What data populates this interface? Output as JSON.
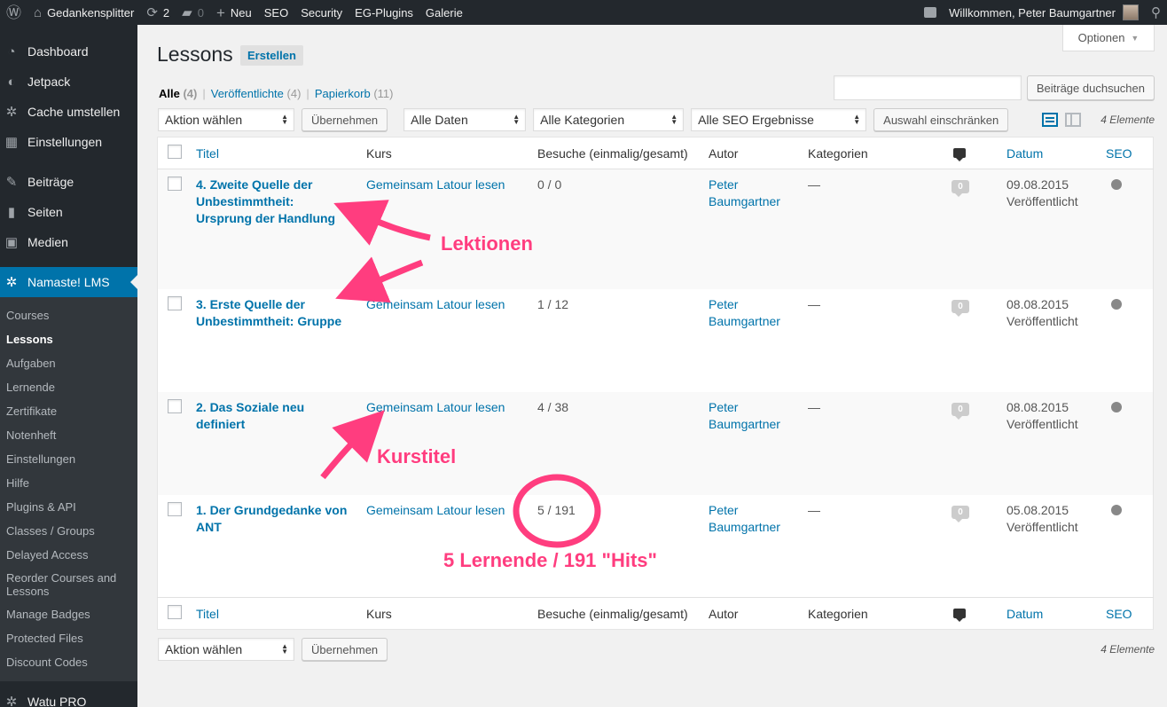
{
  "adminbar": {
    "site_name": "Gedankensplitter",
    "updates": "2",
    "comments": "0",
    "new": "Neu",
    "seo": "SEO",
    "security": "Security",
    "eg_plugins": "EG-Plugins",
    "gallery": "Galerie",
    "greeting": "Willkommen, Peter Baumgartner"
  },
  "sidebar": {
    "top_items": [
      {
        "label": "Dashboard",
        "icon": "dashboard-icon"
      },
      {
        "label": "Jetpack",
        "icon": "jetpack-icon"
      },
      {
        "label": "Cache umstellen",
        "icon": "gear-icon"
      },
      {
        "label": "Einstellungen",
        "icon": "settings-icon"
      }
    ],
    "mid_items": [
      {
        "label": "Beiträge",
        "icon": "pin-icon"
      },
      {
        "label": "Seiten",
        "icon": "pages-icon"
      },
      {
        "label": "Medien",
        "icon": "media-icon"
      }
    ],
    "active": "Namaste! LMS",
    "submenu": [
      "Courses",
      "Lessons",
      "Aufgaben",
      "Lernende",
      "Zertifikate",
      "Notenheft",
      "Einstellungen",
      "Hilfe",
      "Plugins & API",
      "Classes / Groups",
      "Delayed Access",
      "Reorder Courses and Lessons",
      "Manage Badges",
      "Protected Files",
      "Discount Codes"
    ],
    "bottom": "Watu PRO"
  },
  "page": {
    "title": "Lessons",
    "add_new": "Erstellen",
    "screen_options": "Optionen"
  },
  "filters": {
    "all_label": "Alle",
    "all_count": "(4)",
    "published_label": "Veröffentlichte",
    "published_count": "(4)",
    "trash_label": "Papierkorb",
    "trash_count": "(11)"
  },
  "search": {
    "value": "",
    "button": "Beiträge duchsuchen"
  },
  "tablenav_top": {
    "bulk_action": "Aktion wählen",
    "apply": "Übernehmen",
    "dates": "Alle Daten",
    "categories": "Alle Kategorien",
    "seo": "Alle SEO Ergebnisse",
    "filter": "Auswahl einschränken",
    "count": "4 Elemente"
  },
  "tablenav_bottom": {
    "bulk_action": "Aktion wählen",
    "apply": "Übernehmen",
    "count": "4 Elemente"
  },
  "table": {
    "headers": {
      "title": "Titel",
      "course": "Kurs",
      "visits": "Besuche (einmalig/gesamt)",
      "author": "Autor",
      "categories": "Kategorien",
      "date": "Datum",
      "seo": "SEO"
    },
    "rows": [
      {
        "title": "4. Zweite Quelle der Unbestimmtheit: Ursprung der Handlung",
        "course": "Gemeinsam Latour lesen",
        "visits": "0 / 0",
        "author": "Peter Baumgartner",
        "categories": "—",
        "comments": "0",
        "date": "09.08.2015",
        "status": "Veröffentlicht"
      },
      {
        "title": "3. Erste Quelle der Unbestimmtheit: Gruppe",
        "course": "Gemeinsam Latour lesen",
        "visits": "1 / 12",
        "author": "Peter Baumgartner",
        "categories": "—",
        "comments": "0",
        "date": "08.08.2015",
        "status": "Veröffentlicht"
      },
      {
        "title": "2. Das Soziale neu definiert",
        "course": "Gemeinsam Latour lesen",
        "visits": "4 / 38",
        "author": "Peter Baumgartner",
        "categories": "—",
        "comments": "0",
        "date": "08.08.2015",
        "status": "Veröffentlicht"
      },
      {
        "title": "1. Der Grundgedanke von ANT",
        "course": "Gemeinsam Latour lesen",
        "visits": "5 / 191",
        "author": "Peter Baumgartner",
        "categories": "—",
        "comments": "0",
        "date": "05.08.2015",
        "status": "Veröffentlicht"
      }
    ]
  },
  "annotations": {
    "lessons": "Lektionen",
    "course_title": "Kurstitel",
    "learners_hits": "5 Lernende / 191 \"Hits\"",
    "color": "#ff3d7f"
  }
}
